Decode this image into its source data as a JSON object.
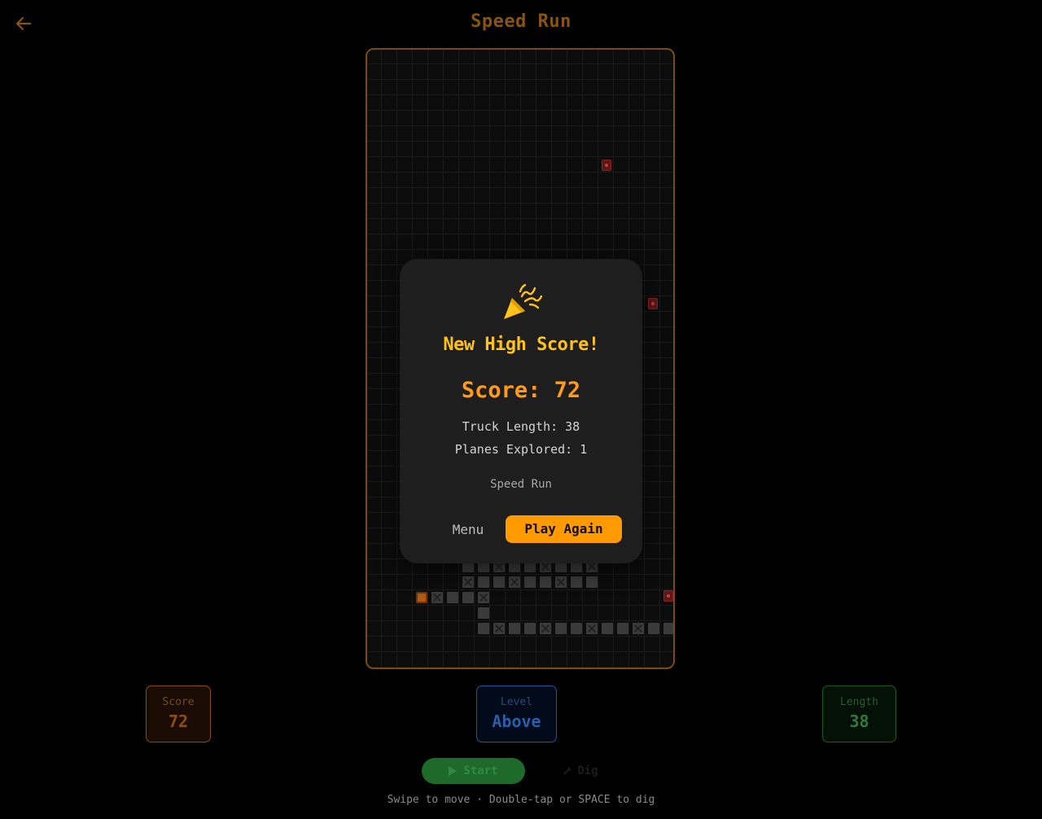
{
  "header": {
    "title": "Speed Run",
    "back_icon": "arrow-left-icon"
  },
  "modal": {
    "icon": "party-popper-icon",
    "heading": "New High Score!",
    "score_text": "Score: 72",
    "truck_length_text": "Truck Length: 38",
    "planes_explored_text": "Planes Explored: 1",
    "mode_text": "Speed Run",
    "menu_label": "Menu",
    "play_again_label": "Play Again"
  },
  "stats": {
    "score": {
      "label": "Score",
      "value": "72"
    },
    "level": {
      "label": "Level",
      "value": "Above"
    },
    "length": {
      "label": "Length",
      "value": "38"
    }
  },
  "controls": {
    "start_label": "Start",
    "dig_label": "Dig"
  },
  "hint": "Swipe to move · Double-tap or SPACE to dig",
  "colors": {
    "accent_orange": "#ff9a00",
    "heading_yellow": "#ffc21a",
    "board_border": "#7a4a0e"
  }
}
